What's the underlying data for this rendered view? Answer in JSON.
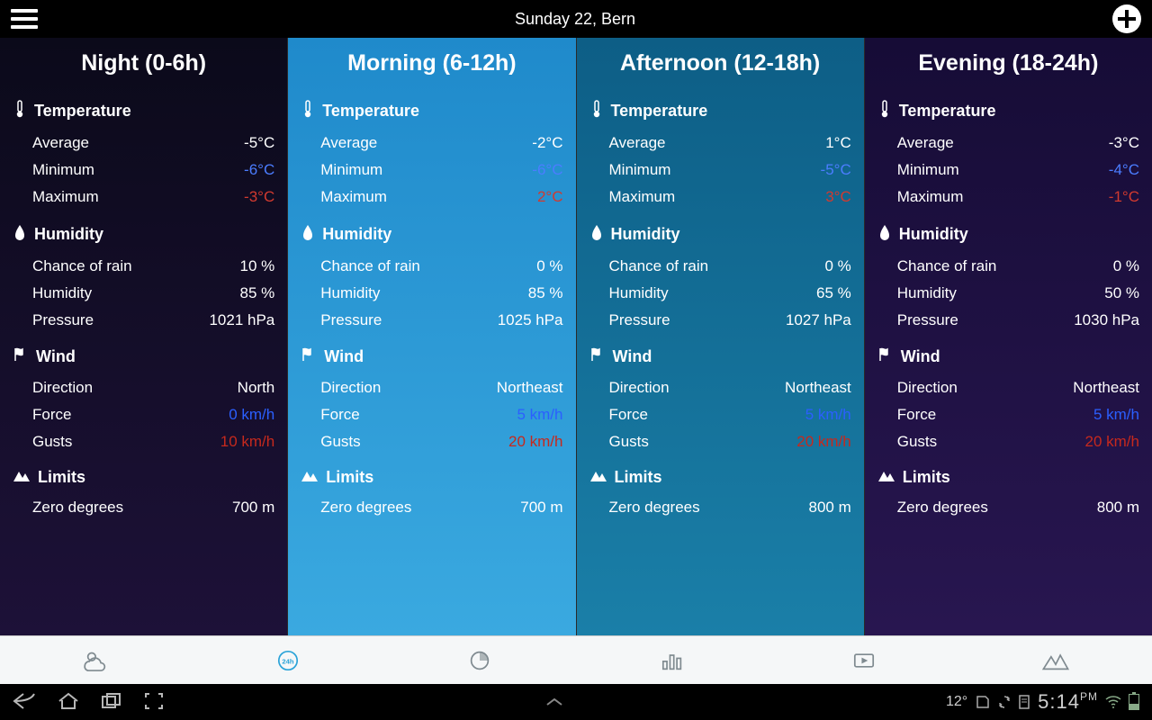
{
  "header": {
    "title": "Sunday 22, Bern"
  },
  "sections": {
    "temperature": "Temperature",
    "humidity": "Humidity",
    "wind": "Wind",
    "limits": "Limits"
  },
  "labels": {
    "average": "Average",
    "minimum": "Minimum",
    "maximum": "Maximum",
    "chance_of_rain": "Chance of rain",
    "humidity": "Humidity",
    "pressure": "Pressure",
    "direction": "Direction",
    "force": "Force",
    "gusts": "Gusts",
    "zero_degrees": "Zero degrees"
  },
  "columns": [
    {
      "key": "night",
      "title": "Night (0-6h)",
      "temperature": {
        "average": "-5°C",
        "minimum": "-6°C",
        "maximum": "-3°C"
      },
      "humidity": {
        "chance_of_rain": "10 %",
        "humidity": "85 %",
        "pressure": "1021 hPa"
      },
      "wind": {
        "direction": "North",
        "force": "0 km/h",
        "gusts": "10 km/h"
      },
      "limits": {
        "zero_degrees": "700 m"
      }
    },
    {
      "key": "morning",
      "title": "Morning (6-12h)",
      "temperature": {
        "average": "-2°C",
        "minimum": "-6°C",
        "maximum": "2°C"
      },
      "humidity": {
        "chance_of_rain": "0 %",
        "humidity": "85 %",
        "pressure": "1025 hPa"
      },
      "wind": {
        "direction": "Northeast",
        "force": "5 km/h",
        "gusts": "20 km/h"
      },
      "limits": {
        "zero_degrees": "700 m"
      }
    },
    {
      "key": "afternoon",
      "title": "Afternoon (12-18h)",
      "temperature": {
        "average": "1°C",
        "minimum": "-5°C",
        "maximum": "3°C"
      },
      "humidity": {
        "chance_of_rain": "0 %",
        "humidity": "65 %",
        "pressure": "1027 hPa"
      },
      "wind": {
        "direction": "Northeast",
        "force": "5 km/h",
        "gusts": "20 km/h"
      },
      "limits": {
        "zero_degrees": "800 m"
      }
    },
    {
      "key": "evening",
      "title": "Evening (18-24h)",
      "temperature": {
        "average": "-3°C",
        "minimum": "-4°C",
        "maximum": "-1°C"
      },
      "humidity": {
        "chance_of_rain": "0 %",
        "humidity": "50 %",
        "pressure": "1030 hPa"
      },
      "wind": {
        "direction": "Northeast",
        "force": "5 km/h",
        "gusts": "20 km/h"
      },
      "limits": {
        "zero_degrees": "800 m"
      }
    }
  ],
  "tabs": {
    "forecast": "forecast",
    "twentyfour": "24h",
    "pie": "pie",
    "bars": "bars",
    "video": "video",
    "mountains": "mountains",
    "active": "twentyfour"
  },
  "statusbar": {
    "temp_small": "12°",
    "time": "5:14",
    "ampm": "PM"
  }
}
